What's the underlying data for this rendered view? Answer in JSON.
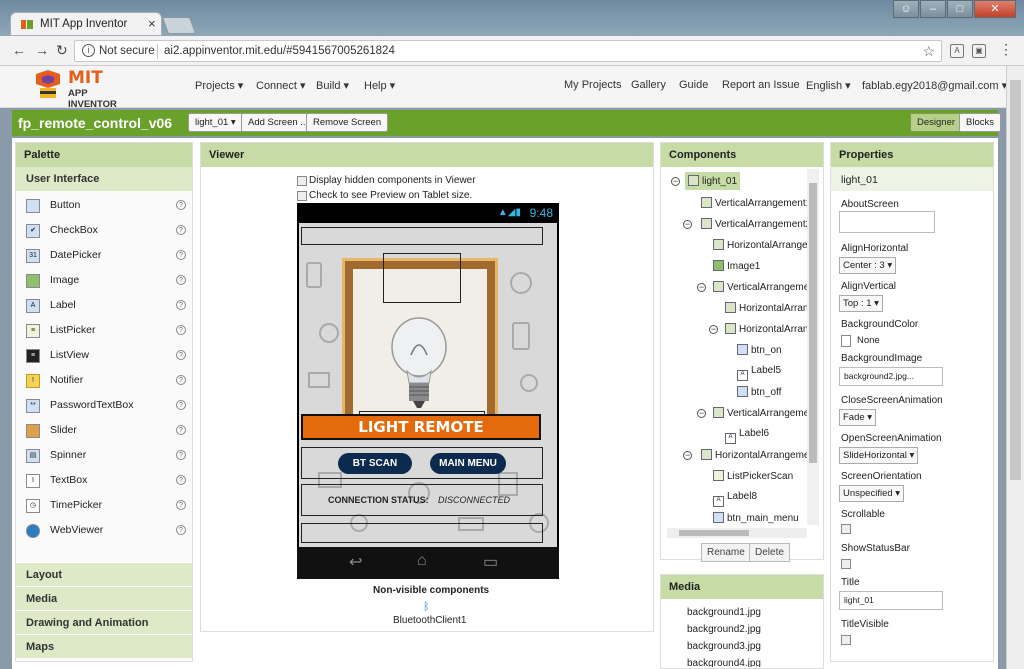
{
  "browser": {
    "tab_title": "MIT App Inventor",
    "tab_close": "×",
    "not_secure": "Not secure",
    "url": "ai2.appinventor.mit.edu/#5941567005261824"
  },
  "app_header": {
    "logo_mit": "MIT",
    "logo_sub": "APP INVENTOR",
    "menu_left": [
      "Projects ▾",
      "Connect ▾",
      "Build ▾",
      "Help ▾"
    ],
    "menu_right": [
      "My Projects",
      "Gallery",
      "Guide",
      "Report an Issue",
      "English ▾",
      "fablab.egy2018@gmail.com ▾"
    ]
  },
  "project_bar": {
    "project_name": "fp_remote_control_v06",
    "screen_select": "light_01 ▾",
    "add_screen": "Add Screen ...",
    "remove_screen": "Remove Screen",
    "designer": "Designer",
    "blocks": "Blocks"
  },
  "palette": {
    "title": "Palette",
    "category": "User Interface",
    "items": [
      "Button",
      "CheckBox",
      "DatePicker",
      "Image",
      "Label",
      "ListPicker",
      "ListView",
      "Notifier",
      "PasswordTextBox",
      "Slider",
      "Spinner",
      "TextBox",
      "TimePicker",
      "WebViewer"
    ],
    "other_categories": [
      "Layout",
      "Media",
      "Drawing and Animation",
      "Maps"
    ]
  },
  "viewer": {
    "title": "Viewer",
    "chk_hidden": "Display hidden components in Viewer",
    "chk_tablet": "Check to see Preview on Tablet size.",
    "phone_time": "9:48",
    "light_remote": "LIGHT REMOTE",
    "bt_scan": "BT SCAN",
    "main_menu": "MAIN MENU",
    "conn_label": "CONNECTION STATUS:",
    "conn_value": "DISCONNECTED",
    "nonvisible_title": "Non-visible components",
    "nonvisible_item": "BluetoothClient1"
  },
  "components": {
    "title": "Components",
    "tree": [
      "light_01",
      "VerticalArrangement1",
      "VerticalArrangement2",
      "HorizontalArrangen",
      "Image1",
      "VerticalArrangemer",
      "HorizontalArrang",
      "HorizontalArrang",
      "btn_on",
      "Label5",
      "btn_off",
      "VerticalArrangemer",
      "Label6",
      "HorizontalArrangemer",
      "ListPickerScan",
      "Label8",
      "btn_main_menu"
    ],
    "rename": "Rename",
    "delete": "Delete"
  },
  "media": {
    "title": "Media",
    "files": [
      "background1.jpg",
      "background2.jpg",
      "background3.jpg",
      "background4.jpg"
    ]
  },
  "properties": {
    "title": "Properties",
    "component": "light_01",
    "about_screen": "AboutScreen",
    "align_h_label": "AlignHorizontal",
    "align_h_value": "Center : 3 ▾",
    "align_v_label": "AlignVertical",
    "align_v_value": "Top : 1 ▾",
    "bg_color_label": "BackgroundColor",
    "bg_color_value": "None",
    "bg_image_label": "BackgroundImage",
    "bg_image_value": "background2.jpg...",
    "close_anim_label": "CloseScreenAnimation",
    "close_anim_value": "Fade ▾",
    "open_anim_label": "OpenScreenAnimation",
    "open_anim_value": "SlideHorizontal ▾",
    "orientation_label": "ScreenOrientation",
    "orientation_value": "Unspecified ▾",
    "scrollable_label": "Scrollable",
    "show_status_label": "ShowStatusBar",
    "title_label": "Title",
    "title_value": "light_01",
    "title_visible_label": "TitleVisible"
  },
  "colors": {
    "green_bar": "#6aa12b",
    "panel_header": "#c7dba6",
    "phone_orange": "#e46a0c",
    "phone_button": "#0c2a4d"
  }
}
